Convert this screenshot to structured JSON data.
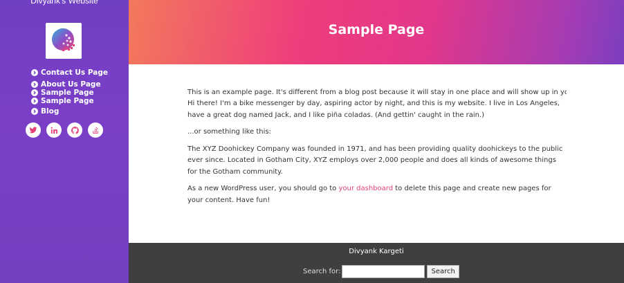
{
  "sidebar": {
    "site_title": "Divyank's Website",
    "logo_icon": "globe-dots-logo",
    "nav": [
      {
        "label": "Contact Us Page",
        "icon": "chevron-right-icon"
      },
      {
        "label": "About Us Page",
        "icon": "chevron-right-icon"
      },
      {
        "label": "Sample Page",
        "icon": "chevron-right-icon"
      },
      {
        "label": "Sample Page",
        "icon": "chevron-right-icon"
      },
      {
        "label": "Blog",
        "icon": "chevron-right-icon"
      }
    ],
    "socials": [
      "twitter-icon",
      "linkedin-icon",
      "github-icon",
      "stackoverflow-icon"
    ],
    "accent_color": "#e5407a"
  },
  "header": {
    "title": "Sample Page"
  },
  "main": {
    "intro": "This is an example page. It's different from a blog post because it will stay in one place and will show up in your site",
    "p1": "Hi there! I'm a bike messenger by day, aspiring actor by night, and this is my website. I live in Los Angeles, have a great dog named Jack, and I like piña coladas. (And gettin' caught in the rain.)",
    "p2": "...or something like this:",
    "p3": "The XYZ Doohickey Company was founded in 1971, and has been providing quality doohickeys to the public ever since. Located in Gotham City, XYZ employs over 2,000 people and does all kinds of awesome things for the Gotham community.",
    "p4_before": "As a new WordPress user, you should go to ",
    "p4_link": "your dashboard",
    "p4_after": " to delete this page and create new pages for your content. Have fun!"
  },
  "footer": {
    "name": "Divyank Kargeti",
    "search_label": "Search for:",
    "search_value": "",
    "search_button": "Search"
  }
}
